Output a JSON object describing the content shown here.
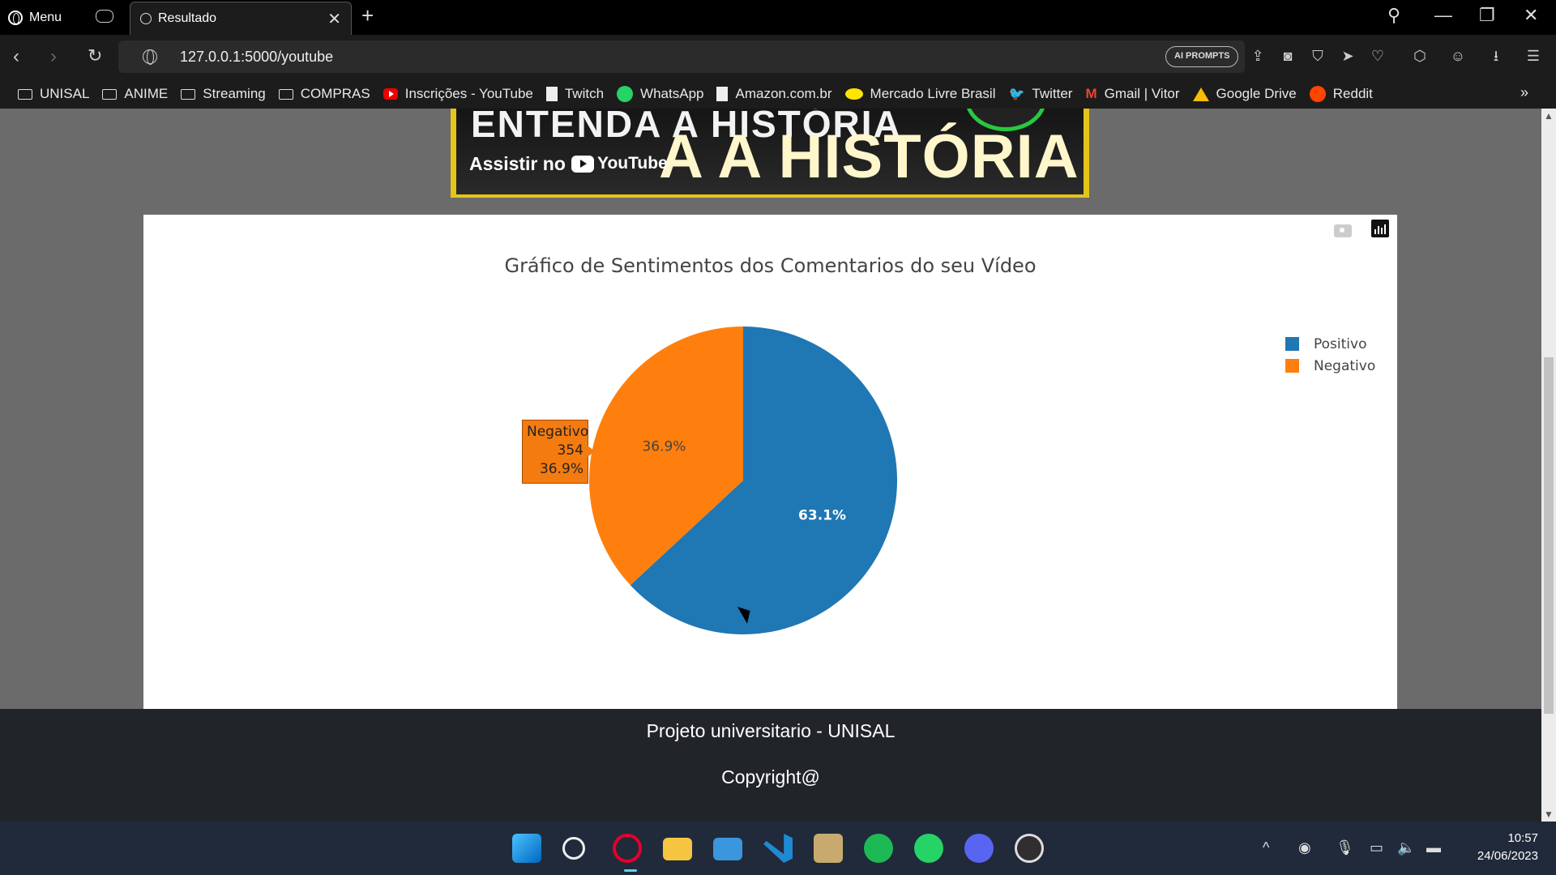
{
  "browser": {
    "menu_label": "Menu",
    "tab_title": "Resultado",
    "url": "127.0.0.1:5000/youtube",
    "ai_prompts_label": "AI PROMPTS",
    "toolbar_icons": [
      "share-icon",
      "camera-icon",
      "shield-icon",
      "send-icon",
      "heart-icon",
      "cube-icon",
      "profile-icon",
      "download-icon",
      "menu-icon"
    ]
  },
  "bookmarks": [
    {
      "label": "UNISAL",
      "icon": "folder-icon"
    },
    {
      "label": "ANIME",
      "icon": "folder-icon"
    },
    {
      "label": "Streaming",
      "icon": "folder-icon"
    },
    {
      "label": "COMPRAS",
      "icon": "folder-icon"
    },
    {
      "label": "Inscrições - YouTube",
      "icon": "youtube-icon"
    },
    {
      "label": "Twitch",
      "icon": "document-icon"
    },
    {
      "label": "WhatsApp",
      "icon": "whatsapp-icon"
    },
    {
      "label": "Amazon.com.br",
      "icon": "document-icon"
    },
    {
      "label": "Mercado Livre Brasil",
      "icon": "mercadolivre-icon"
    },
    {
      "label": "Twitter",
      "icon": "twitter-icon"
    },
    {
      "label": "Gmail | Vitor",
      "icon": "gmail-icon"
    },
    {
      "label": "Google Drive",
      "icon": "google-drive-icon"
    },
    {
      "label": "Reddit",
      "icon": "reddit-icon"
    }
  ],
  "banner": {
    "headline": "ENTENDA A HISTÓRIA",
    "headline_visible": "A A HISTÓRIA",
    "cta_prefix": "Assistir no",
    "cta_platform": "YouTube"
  },
  "chart_data": {
    "type": "pie",
    "title": "Gráfico de Sentimentos dos Comentarios do seu Vídeo",
    "labels": [
      "Positivo",
      "Negativo"
    ],
    "values": [
      605,
      354
    ],
    "percent_labels": [
      "63.1%",
      "36.9%"
    ],
    "colors": [
      "#1f77b4",
      "#ff7f0e"
    ],
    "legend_position": "top-right",
    "hover": {
      "label": "Negativo",
      "value": "354",
      "percent": "36.9%"
    }
  },
  "footer": {
    "line1": "Projeto universitario - UNISAL",
    "line2": "Copyright@"
  },
  "taskbar": {
    "apps": [
      "windows-start-icon",
      "search-icon",
      "opera-icon",
      "file-explorer-icon",
      "mail-icon",
      "vscode-icon",
      "league-of-legends-icon",
      "spotify-icon",
      "whatsapp-icon",
      "discord-icon",
      "obs-icon"
    ],
    "time": "10:57",
    "date": "24/06/2023"
  }
}
